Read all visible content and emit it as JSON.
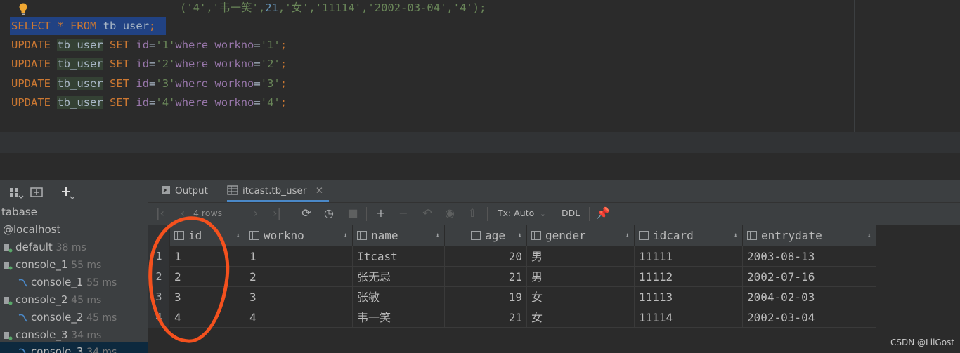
{
  "editor": {
    "line0": {
      "open": "('",
      "v1": "4",
      "c1": "','",
      "v2": "韦一笑",
      "c2": "',",
      "v3": "21",
      "c3": ",'",
      "v4": "女",
      "c4": "','",
      "v5": "11114",
      "c5": "','",
      "v6": "2002-03-04",
      "c6": "','",
      "v7": "4",
      "close": "');"
    },
    "select_line": {
      "kw1": "SELECT",
      "star": "*",
      "kw2": "FROM",
      "table": "tb_user",
      "end": ";"
    },
    "updates": [
      {
        "kw": "UPDATE",
        "table": "tb_user",
        "set": "SET",
        "c1": "id",
        "eq1": "=",
        "v1": "'1'",
        "where": "where",
        "c2": "workno",
        "eq2": "=",
        "v2": "'1'",
        "end": ";"
      },
      {
        "kw": "UPDATE",
        "table": "tb_user",
        "set": "SET",
        "c1": "id",
        "eq1": "=",
        "v1": "'2'",
        "where": "where",
        "c2": "workno",
        "eq2": "=",
        "v2": "'2'",
        "end": ";"
      },
      {
        "kw": "UPDATE",
        "table": "tb_user",
        "set": "SET",
        "c1": "id",
        "eq1": "=",
        "v1": "'3'",
        "where": "where",
        "c2": "workno",
        "eq2": "=",
        "v2": "'3'",
        "end": ";"
      },
      {
        "kw": "UPDATE",
        "table": "tb_user",
        "set": "SET",
        "c1": "id",
        "eq1": "=",
        "v1": "'4'",
        "where": "where",
        "c2": "workno",
        "eq2": "=",
        "v2": "'4'",
        "end": ";"
      }
    ]
  },
  "db_panel": {
    "items": [
      {
        "label": "tabase",
        "ms": ""
      },
      {
        "label": "@localhost",
        "ms": ""
      },
      {
        "label": "default",
        "ms": "38 ms"
      },
      {
        "label": "console_1",
        "ms": "55 ms"
      },
      {
        "label": "console_1",
        "ms": "55 ms"
      },
      {
        "label": "console_2",
        "ms": "45 ms"
      },
      {
        "label": "console_2",
        "ms": "45 ms"
      },
      {
        "label": "console_3",
        "ms": "34 ms"
      },
      {
        "label": "console_3",
        "ms": "34 ms"
      }
    ]
  },
  "results": {
    "tabs": [
      {
        "label": "Output"
      },
      {
        "label": "itcast.tb_user"
      }
    ],
    "toolbar": {
      "rows_label": "4 rows",
      "tx_label": "Tx: Auto",
      "ddl_label": "DDL"
    },
    "columns": [
      "id",
      "workno",
      "name",
      "age",
      "gender",
      "idcard",
      "entrydate"
    ],
    "rows": [
      {
        "n": "1",
        "id": "1",
        "workno": "1",
        "name": "Itcast",
        "age": "20",
        "gender": "男",
        "idcard": "11111",
        "entrydate": "2003-08-13"
      },
      {
        "n": "2",
        "id": "2",
        "workno": "2",
        "name": "张无忌",
        "age": "21",
        "gender": "男",
        "idcard": "11112",
        "entrydate": "2002-07-16"
      },
      {
        "n": "3",
        "id": "3",
        "workno": "3",
        "name": "张敏",
        "age": "19",
        "gender": "女",
        "idcard": "11113",
        "entrydate": "2004-02-03"
      },
      {
        "n": "4",
        "id": "4",
        "workno": "4",
        "name": "韦一笑",
        "age": "21",
        "gender": "女",
        "idcard": "11114",
        "entrydate": "2002-03-04"
      }
    ]
  },
  "watermark": "CSDN @LilGost",
  "colors": {
    "accent": "#4a88c7",
    "annotation": "#f4511e",
    "selection": "#214283"
  }
}
